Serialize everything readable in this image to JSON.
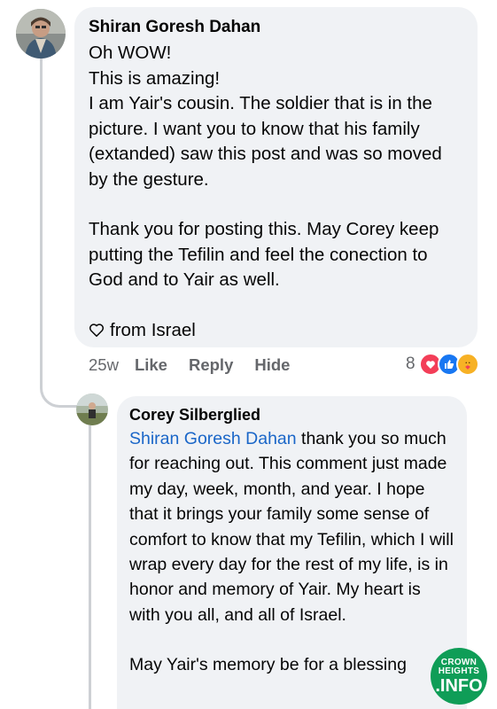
{
  "comment": {
    "author": "Shiran Goresh Dahan",
    "lines": [
      "Oh WOW!",
      "This is amazing!",
      "I am Yair's cousin. The soldier that is in the picture. I want you to know that his family (extanded) saw this post and was so moved by the gesture.",
      "",
      "Thank you for posting this. May Corey keep putting the Tefilin and feel the conection to God and to Yair as well.",
      ""
    ],
    "signoff": "from Israel",
    "signoff_icon": "heart-outline-icon",
    "time": "25w",
    "like_label": "Like",
    "reply_label": "Reply",
    "hide_label": "Hide",
    "reaction_count": "8",
    "reaction_icons": [
      "love-reaction-icon",
      "like-reaction-icon",
      "care-reaction-icon"
    ]
  },
  "reply": {
    "author": "Corey Silberglied",
    "mention": "Shiran Goresh Dahan",
    "text_after_mention": " thank you so much for reaching out. This comment just made my day, week, month, and year. I hope that it brings your family some sense of comfort to know that my Tefilin, which I will wrap every day for the rest of my life, is in honor and memory of Yair. My heart is with you all, and all of Israel.",
    "closing": "May Yair's memory be for a blessing"
  },
  "watermark": {
    "line1": "CROWN",
    "line2": "HEIGHTS",
    "line3": ".INFO"
  },
  "colors": {
    "bubble": "#f0f2f5",
    "mention": "#1a66c8",
    "meta": "#65676b",
    "watermark": "#0f9d57"
  }
}
